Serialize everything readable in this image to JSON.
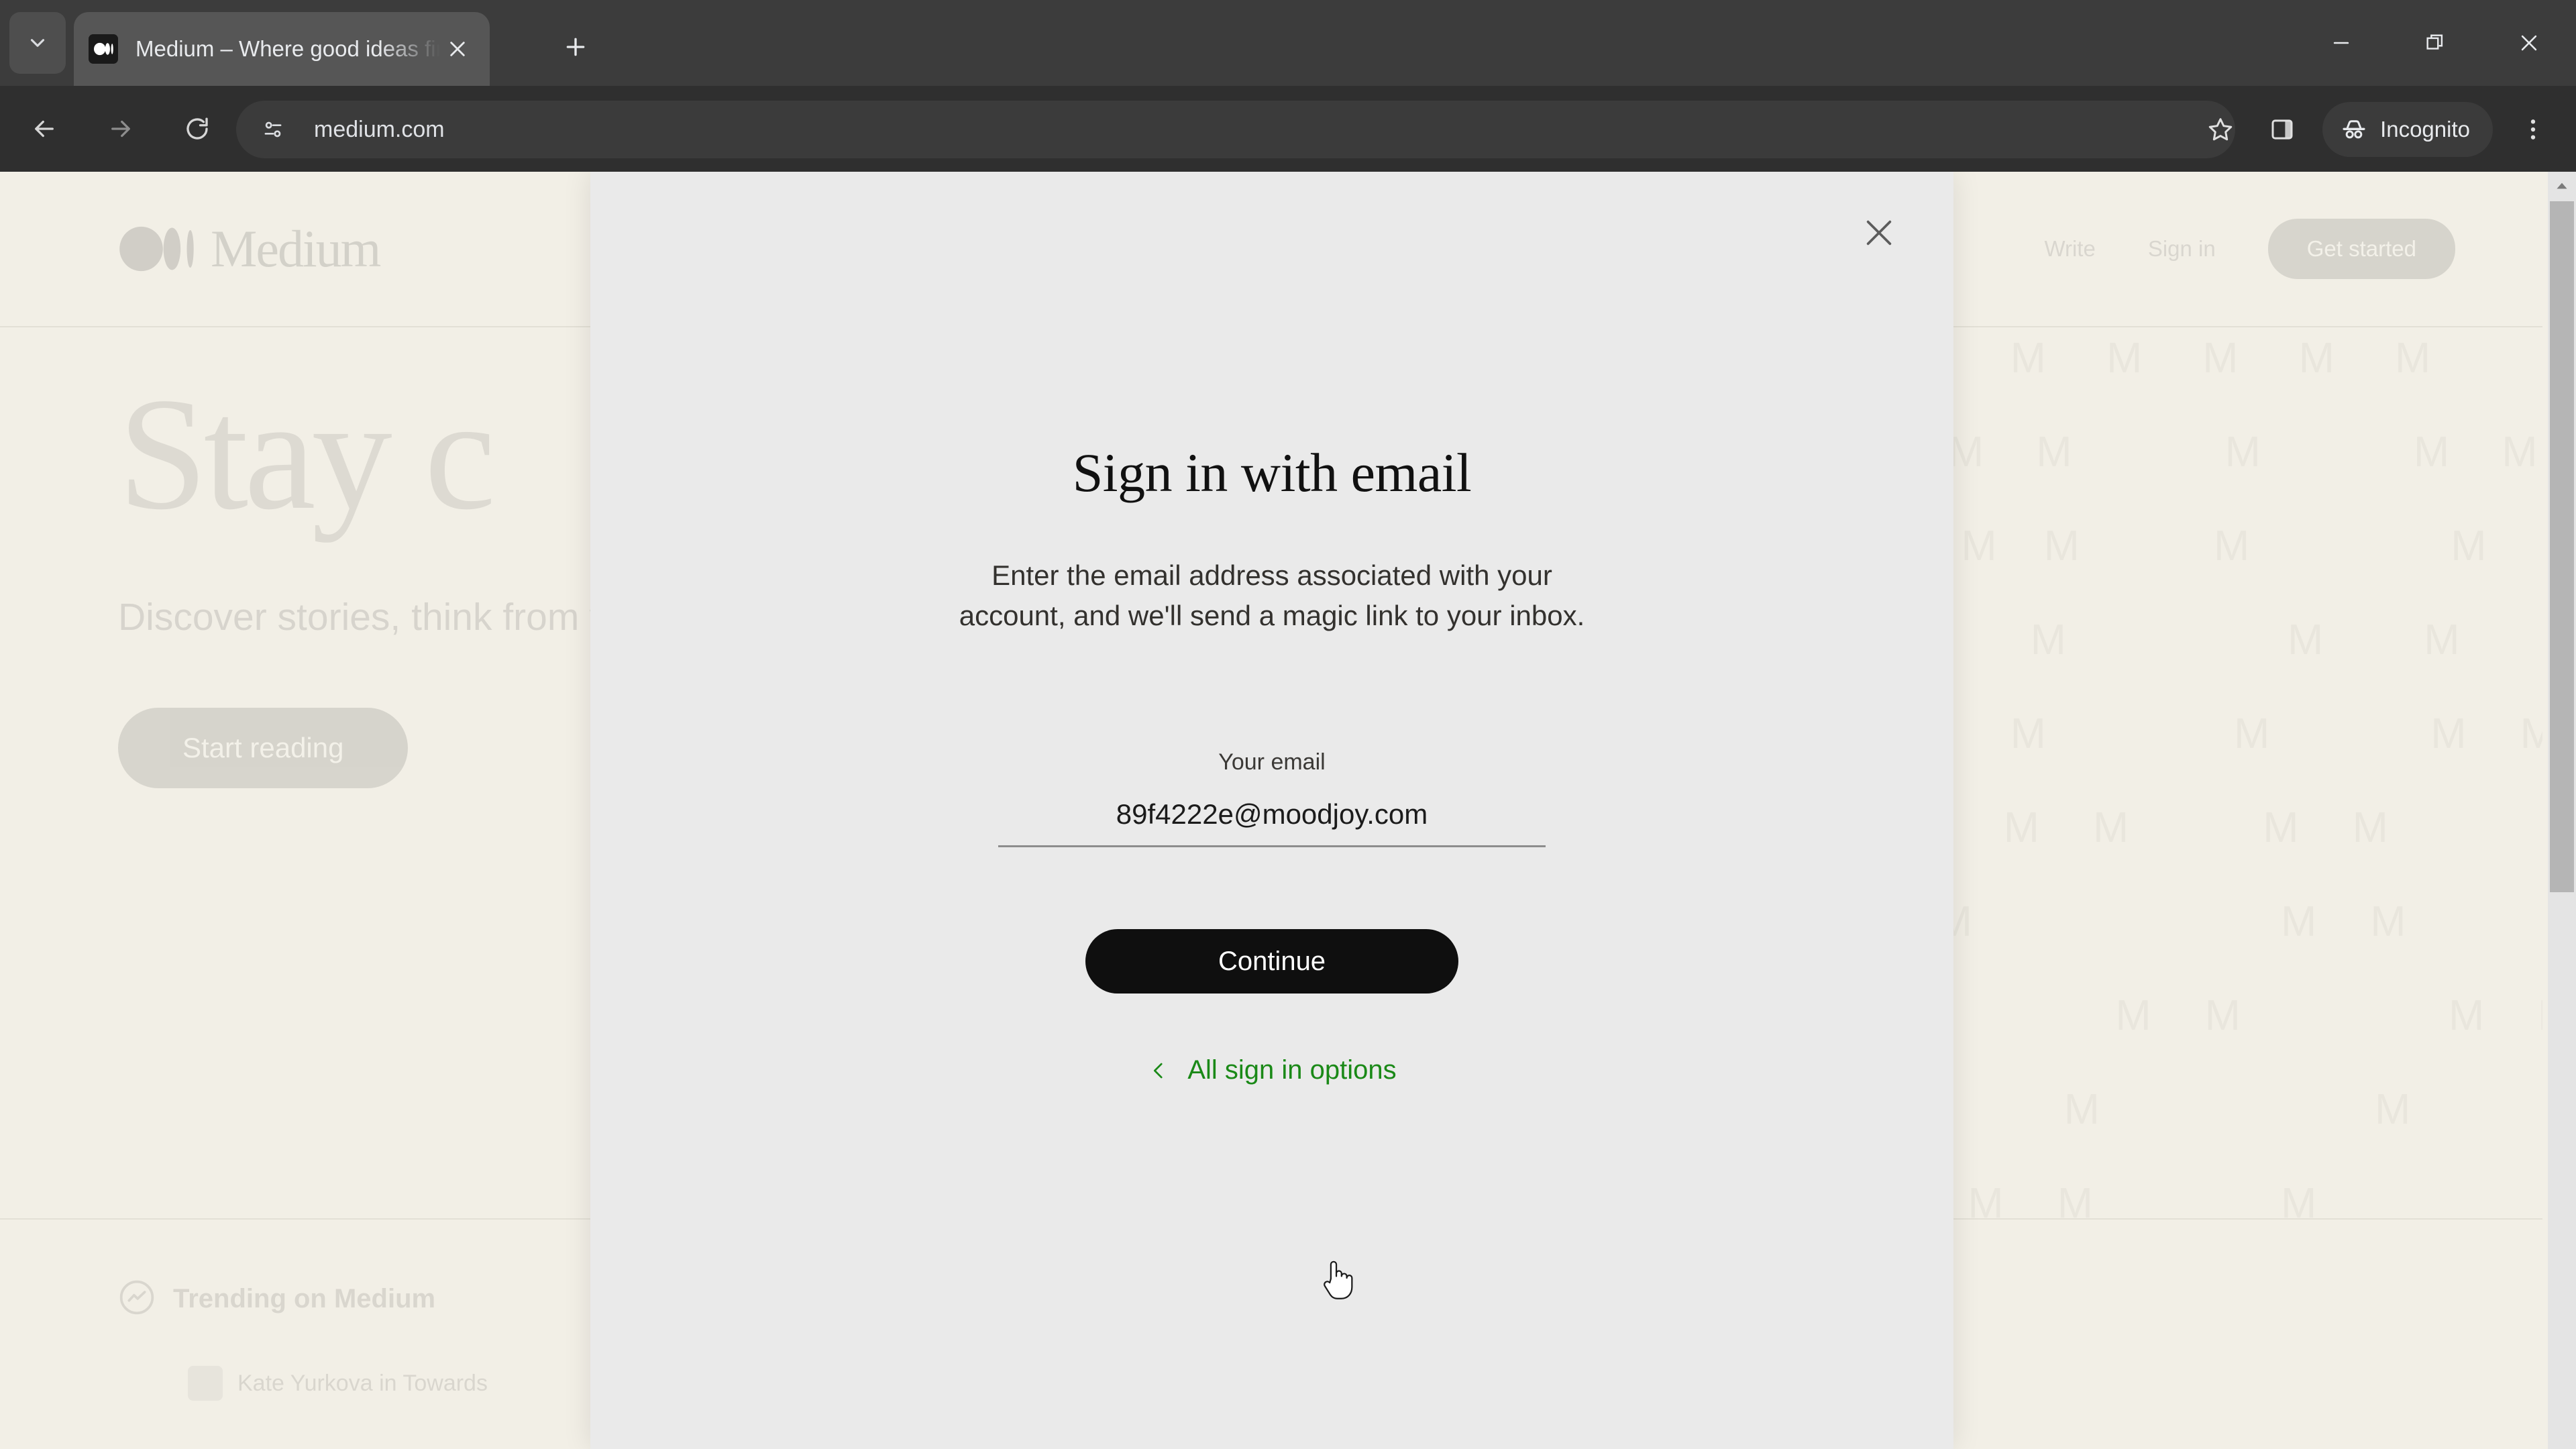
{
  "browser": {
    "tab": {
      "title": "Medium – Where good ideas find you.",
      "favicon": "medium-logo-icon",
      "close": "×"
    },
    "new_tab_label": "+",
    "window_controls": {
      "minimize": "—",
      "restore": "❐",
      "close": "✕"
    },
    "nav": {
      "back": "←",
      "forward": "→",
      "reload": "⟳"
    },
    "omnibox": {
      "url": "medium.com",
      "site_settings_icon": "tune-icon"
    },
    "actions": {
      "bookmark": "star-icon",
      "side_panel": "side-panel-icon",
      "incognito_label": "Incognito",
      "menu": "three-dot-menu-icon"
    }
  },
  "page": {
    "logo_text": "Medium",
    "nav_links": [
      "Write",
      "Sign in"
    ],
    "cta": "Get started",
    "hero": {
      "title": "Stay c",
      "subtitle": "Discover stories, think\nfrom writers on any to",
      "button": "Start reading"
    },
    "trending_label": "Trending on Medium",
    "trending_item": "Kate Yurkova in Towards",
    "pattern_letter": "M"
  },
  "modal": {
    "close_label": "✕",
    "title": "Sign in with email",
    "description": "Enter the email address associated with your account, and we'll send a magic link to your inbox.",
    "email_label": "Your email",
    "email_value": "89f4222e@moodjoy.com",
    "email_placeholder": "Your email",
    "continue_label": "Continue",
    "options_link": "All sign in options",
    "link_color": "#1a8917"
  },
  "scrollbar": {
    "up_arrow": "▲"
  }
}
